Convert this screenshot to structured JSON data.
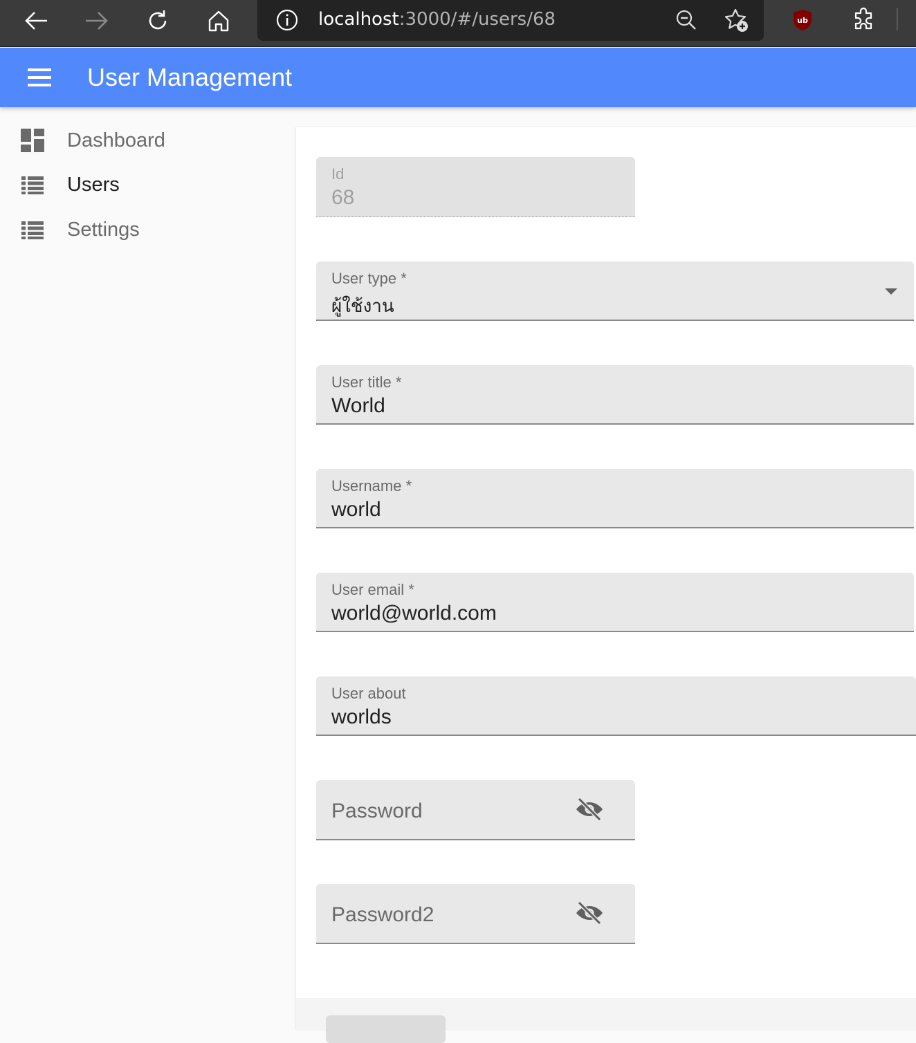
{
  "browser": {
    "url_host": "localhost",
    "url_path": ":3000/#/users/68",
    "icons": [
      "back-arrow-icon",
      "forward-arrow-icon",
      "reload-icon",
      "home-icon",
      "site-info-icon",
      "zoom-out-icon",
      "add-favorite-icon",
      "ublock-icon",
      "extensions-icon"
    ]
  },
  "appbar": {
    "title": "User Management",
    "color": "#5189fd"
  },
  "sidebar": {
    "items": [
      {
        "label": "Dashboard",
        "icon": "dashboard-icon",
        "active": false
      },
      {
        "label": "Users",
        "icon": "list-icon",
        "active": true
      },
      {
        "label": "Settings",
        "icon": "list-icon",
        "active": false
      }
    ]
  },
  "form": {
    "id": {
      "label": "Id",
      "value": "68"
    },
    "user_type": {
      "label": "User type *",
      "value": "ผู้ใช้งาน"
    },
    "user_title": {
      "label": "User title *",
      "value": "World"
    },
    "username": {
      "label": "Username *",
      "value": "world"
    },
    "user_email": {
      "label": "User email *",
      "value": "world@world.com"
    },
    "user_about": {
      "label": "User about",
      "value": "worlds"
    },
    "password": {
      "placeholder": "Password",
      "icon": "visibility-off-icon"
    },
    "password2": {
      "placeholder": "Password2",
      "icon": "visibility-off-icon"
    }
  }
}
